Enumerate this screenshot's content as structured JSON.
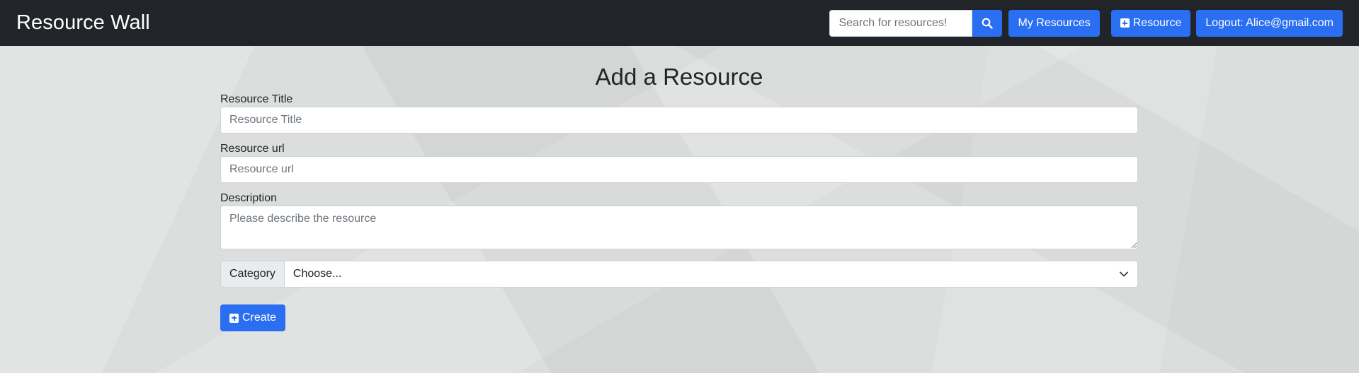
{
  "navbar": {
    "brand": "Resource Wall",
    "search_placeholder": "Search for resources!",
    "search_icon": "search-icon",
    "my_resources_label": "My Resources",
    "add_resource_label": "Resource",
    "add_resource_icon": "plus-square-icon",
    "logout_label": "Logout: Alice@gmail.com",
    "background_color": "#212529",
    "accent_color": "#2a6ff2"
  },
  "form": {
    "title": "Add a Resource",
    "title_field": {
      "label": "Resource Title",
      "placeholder": "Resource Title",
      "value": ""
    },
    "url_field": {
      "label": "Resource url",
      "placeholder": "Resource url",
      "value": ""
    },
    "description_field": {
      "label": "Description",
      "placeholder": "Please describe the resource",
      "value": ""
    },
    "category_field": {
      "label": "Category",
      "selected": "Choose...",
      "icon": "chevron-down-icon"
    },
    "create_button": {
      "label": "Create",
      "icon": "plus-square-icon"
    }
  }
}
